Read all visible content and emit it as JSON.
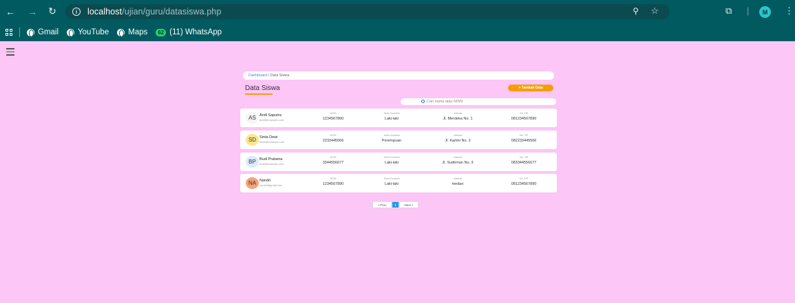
{
  "browser": {
    "url_host": "localhost",
    "url_path": "/ujian/guru/datasiswa.php",
    "profile_initial": "M",
    "bookmarks": [
      {
        "label": "Gmail"
      },
      {
        "label": "YouTube"
      },
      {
        "label": "Maps"
      },
      {
        "label": "(11) WhatsApp",
        "badge": "62"
      }
    ]
  },
  "breadcrumb": {
    "home": "Dashboard",
    "separator": "/",
    "current": "Data Siswa"
  },
  "page": {
    "title": "Data Siswa",
    "add_button": "+ Tambah Data",
    "search_placeholder": "Cari nama atau NISN"
  },
  "columns": {
    "nisn": "NISN",
    "gender": "Jenis Kelamin",
    "address": "Alamat",
    "phone": "No. HP"
  },
  "students": [
    {
      "initials": "AS",
      "avatar_color": "#f5f5f5",
      "name": "Andi Saputra",
      "email": "andi@example.com",
      "nisn": "1234567890",
      "gender": "Laki-laki",
      "address": "Jl. Merdeka No. 1",
      "phone": "081234567890"
    },
    {
      "initials": "SD",
      "avatar_color": "#fde68a",
      "name": "Sinta Dewi",
      "email": "sinta@example.com",
      "nisn": "2233445566",
      "gender": "Perempuan",
      "address": "Jl. Kartini No. 2",
      "phone": "082233445566"
    },
    {
      "initials": "BP",
      "avatar_color": "#dbeafe",
      "name": "Budi Pratama",
      "email": "budi@example.com",
      "nisn": "3344556677",
      "gender": "Laki-laki",
      "address": "Jl. Sudirman No. 3",
      "phone": "083344556677"
    },
    {
      "initials": "NA",
      "avatar_color": "#f4a27a",
      "name": "Nandri",
      "email": "nandri@gmail.com",
      "nisn": "1234567890",
      "gender": "Laki-laki",
      "address": "medan",
      "phone": "081234567890"
    }
  ],
  "pagination": {
    "prev": "« Prev",
    "current": "1",
    "next": "Next »"
  }
}
